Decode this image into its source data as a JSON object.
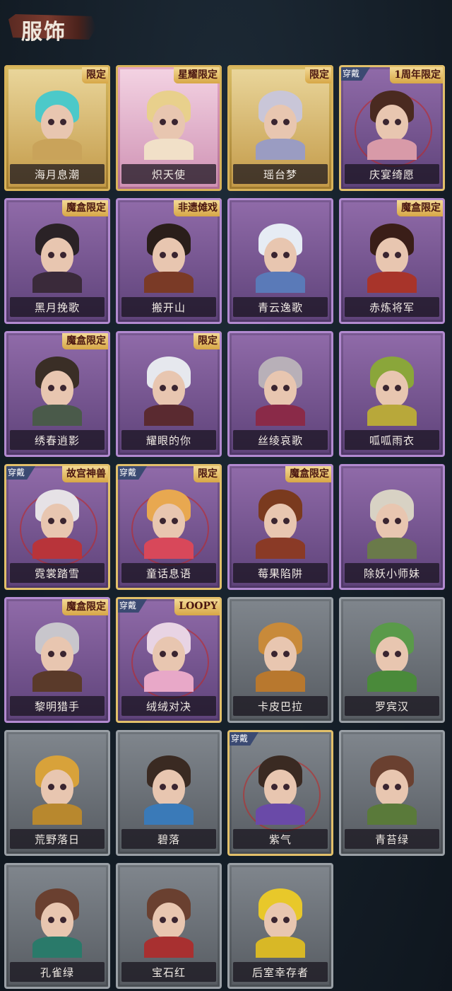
{
  "header": {
    "title": "服饰"
  },
  "cards": [
    {
      "name": "海月息潮",
      "tag": "限定",
      "worn": "",
      "theme": "gold",
      "hair": "#4cc9c9",
      "outfit": "#c9a35a"
    },
    {
      "name": "炽天使",
      "tag": "星耀限定",
      "worn": "",
      "theme": "pink",
      "hair": "#e8d08c",
      "outfit": "#f1e0c8"
    },
    {
      "name": "瑶台梦",
      "tag": "限定",
      "worn": "",
      "theme": "gold",
      "hair": "#c9c6d8",
      "outfit": "#9a9cc2"
    },
    {
      "name": "庆宴绮愿",
      "tag": "1周年限定",
      "worn": "穿戴",
      "theme": "purple",
      "hair": "#4a2a20",
      "outfit": "#d89aa8"
    },
    {
      "name": "黑月挽歌",
      "tag": "魔盒限定",
      "worn": "",
      "theme": "purple",
      "hair": "#2a2226",
      "outfit": "#3a2a3a"
    },
    {
      "name": "搬开山",
      "tag": "非遗傩戏",
      "worn": "",
      "theme": "purple",
      "hair": "#2a1e1a",
      "outfit": "#7a3a26"
    },
    {
      "name": "青云逸歌",
      "tag": "",
      "worn": "",
      "theme": "purple",
      "hair": "#e6ecf4",
      "outfit": "#5a7ab8"
    },
    {
      "name": "赤炼将军",
      "tag": "魔盒限定",
      "worn": "",
      "theme": "purple",
      "hair": "#3a1e18",
      "outfit": "#a8342a"
    },
    {
      "name": "绣春逍影",
      "tag": "魔盒限定",
      "worn": "",
      "theme": "purple",
      "hair": "#3a2e26",
      "outfit": "#4a5a4a"
    },
    {
      "name": "耀眼的你",
      "tag": "限定",
      "worn": "",
      "theme": "purple",
      "hair": "#e6e8ee",
      "outfit": "#5a2a30"
    },
    {
      "name": "丝绫哀歌",
      "tag": "",
      "worn": "",
      "theme": "purple",
      "hair": "#b8b0b8",
      "outfit": "#8a2a48"
    },
    {
      "name": "呱呱雨衣",
      "tag": "",
      "worn": "",
      "theme": "purple",
      "hair": "#8aa63a",
      "outfit": "#b8a83a"
    },
    {
      "name": "霓裳踏雪",
      "tag": "故宫神兽",
      "worn": "穿戴",
      "theme": "purple",
      "hair": "#e6e2e6",
      "outfit": "#b8343a"
    },
    {
      "name": "童话息语",
      "tag": "限定",
      "worn": "穿戴",
      "theme": "purple",
      "hair": "#e8a850",
      "outfit": "#d8485a"
    },
    {
      "name": "莓果陷阱",
      "tag": "魔盒限定",
      "worn": "",
      "theme": "purple",
      "hair": "#7a3a1e",
      "outfit": "#8a3a26"
    },
    {
      "name": "除妖小师妹",
      "tag": "",
      "worn": "",
      "theme": "purple",
      "hair": "#d8d2c4",
      "outfit": "#6a7a4a"
    },
    {
      "name": "黎明猎手",
      "tag": "魔盒限定",
      "worn": "",
      "theme": "purple",
      "hair": "#c8c6cc",
      "outfit": "#5a3a2a"
    },
    {
      "name": "绒绒对决",
      "tag": "LOOPY",
      "worn": "穿戴",
      "theme": "purple",
      "hair": "#e8d4e4",
      "outfit": "#e8a8c8"
    },
    {
      "name": "卡皮巴拉",
      "tag": "",
      "worn": "",
      "theme": "grey",
      "hair": "#c88a3a",
      "outfit": "#b8782e"
    },
    {
      "name": "罗宾汉",
      "tag": "",
      "worn": "",
      "theme": "grey",
      "hair": "#5a9a4a",
      "outfit": "#4a8a3a"
    },
    {
      "name": "荒野落日",
      "tag": "",
      "worn": "",
      "theme": "grey",
      "hair": "#d8a23a",
      "outfit": "#b8882e"
    },
    {
      "name": "碧落",
      "tag": "",
      "worn": "",
      "theme": "grey",
      "hair": "#3a2a22",
      "outfit": "#3a7ab8"
    },
    {
      "name": "紫气",
      "tag": "",
      "worn": "穿戴",
      "theme": "grey",
      "hair": "#3a2a22",
      "outfit": "#6a4aa8"
    },
    {
      "name": "青苔绿",
      "tag": "",
      "worn": "",
      "theme": "grey",
      "hair": "#6a4030",
      "outfit": "#5a7a3a"
    },
    {
      "name": "孔雀绿",
      "tag": "",
      "worn": "",
      "theme": "grey",
      "hair": "#6a4030",
      "outfit": "#2a7a6a"
    },
    {
      "name": "宝石红",
      "tag": "",
      "worn": "",
      "theme": "grey",
      "hair": "#6a4030",
      "outfit": "#a83030"
    },
    {
      "name": "后室幸存者",
      "tag": "",
      "worn": "",
      "theme": "grey",
      "hair": "#e8c82a",
      "outfit": "#d8b826"
    }
  ]
}
